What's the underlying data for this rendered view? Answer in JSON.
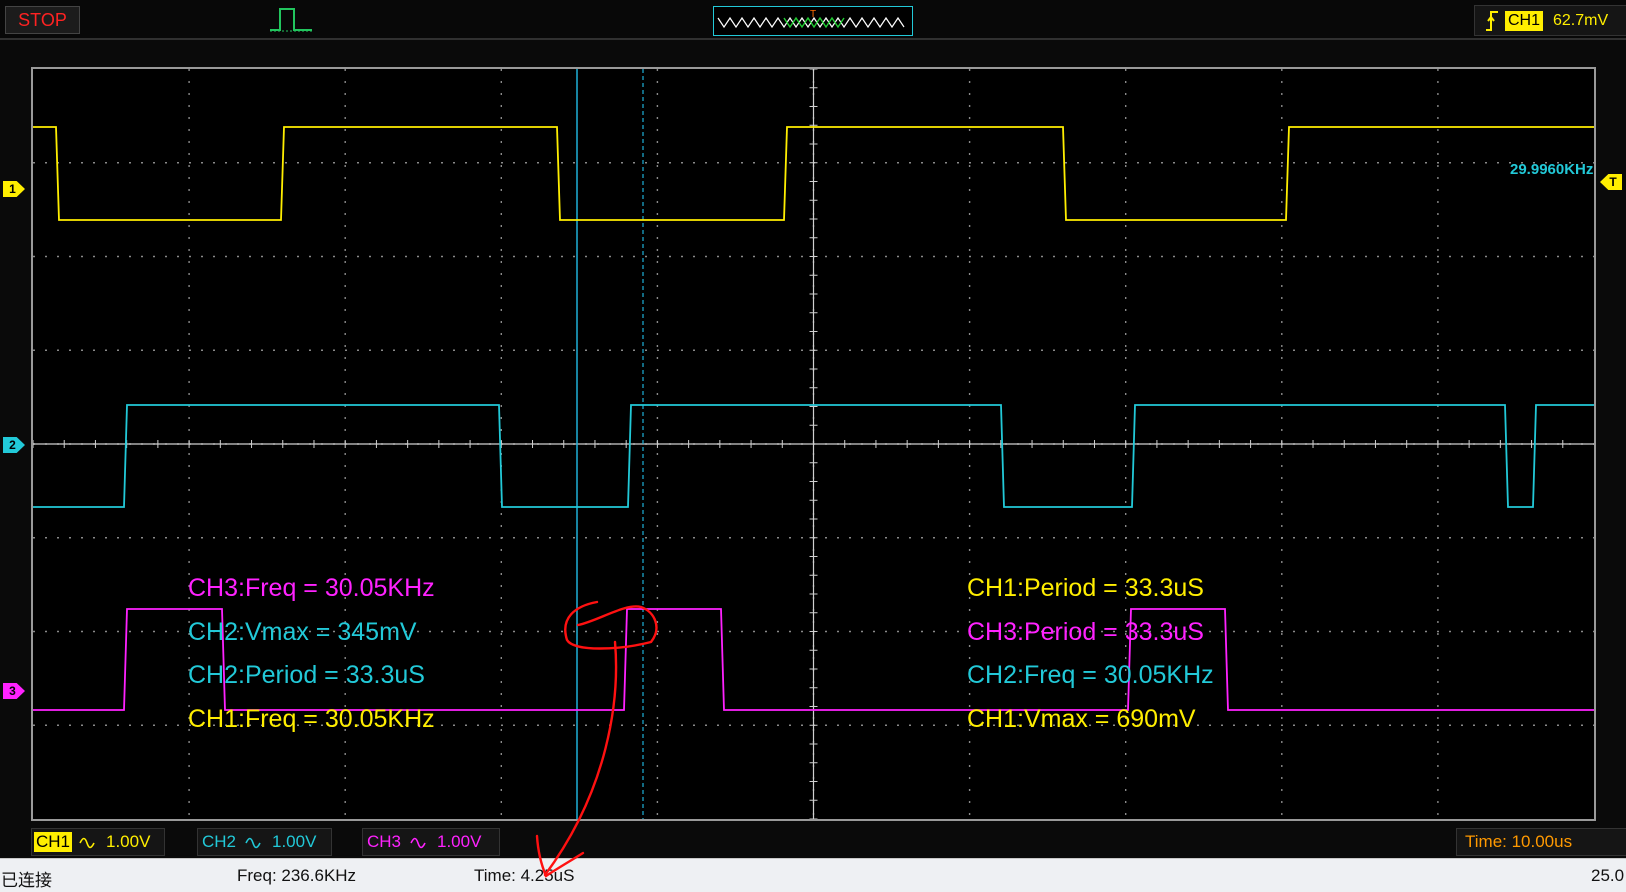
{
  "toolbar": {
    "run_state_label": "STOP",
    "trigger_position_marker": "T",
    "trigger_channel": "CH1",
    "trigger_level": "62.7mV",
    "trigger_edge_icon": "rising-edge-icon",
    "pulse_icon": "pulse-waveform-icon"
  },
  "screen": {
    "grid_divisions": {
      "horizontal": 10,
      "vertical": 8
    },
    "frequency_readout": "29.9960KHz",
    "channel_markers": [
      "1",
      "2",
      "3"
    ],
    "trigger_marker": "T",
    "colors": {
      "ch1": "#ffee00",
      "ch2": "#22c9d8",
      "ch3": "#ff22ff",
      "grid": "#8a8a8a",
      "cursor": "#1fb0d8"
    }
  },
  "measurements": {
    "left": [
      {
        "text": "CH3:Freq = 30.05KHz",
        "channel": "ch3"
      },
      {
        "text": "CH2:Vmax = 345mV",
        "channel": "ch2"
      },
      {
        "text": "CH2:Period = 33.3uS",
        "channel": "ch2"
      },
      {
        "text": "CH1:Freq = 30.05KHz",
        "channel": "ch1"
      }
    ],
    "right": [
      {
        "text": "CH1:Period = 33.3uS",
        "channel": "ch1"
      },
      {
        "text": "CH3:Period = 33.3uS",
        "channel": "ch3"
      },
      {
        "text": "CH2:Freq = 30.05KHz",
        "channel": "ch2"
      },
      {
        "text": "CH1:Vmax = 690mV",
        "channel": "ch1"
      }
    ]
  },
  "channels": [
    {
      "name": "CH1",
      "coupling_icon": "ac-coupling-icon",
      "volts_per_div": "1.00V"
    },
    {
      "name": "CH2",
      "coupling_icon": "ac-coupling-icon",
      "volts_per_div": "1.00V"
    },
    {
      "name": "CH3",
      "coupling_icon": "ac-coupling-icon",
      "volts_per_div": "1.00V"
    }
  ],
  "timebase": "Time: 10.00us",
  "status": {
    "connection": "已连接",
    "freq": "Freq: 236.6KHz",
    "time": "Time: 4.25uS",
    "right_value": "25.0"
  }
}
